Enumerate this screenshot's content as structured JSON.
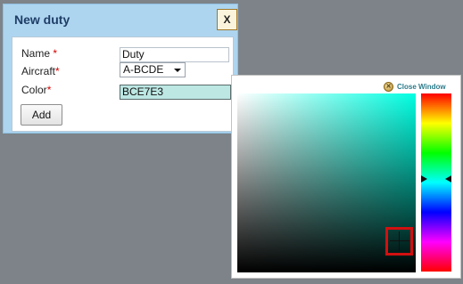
{
  "dialog": {
    "title": "New duty",
    "close_label": "X",
    "fields": {
      "name": {
        "label": "Name",
        "required_mark": "*",
        "value": "Duty"
      },
      "aircraft": {
        "label": "Aircraft",
        "required_mark": "*",
        "value": "A-BCDE"
      },
      "color": {
        "label": "Color",
        "required_mark": "*",
        "value": "BCE7E3",
        "swatch": "#bce7e3"
      }
    },
    "add_label": "Add"
  },
  "color_picker": {
    "close_window_label": "Close Window",
    "close_icon_glyph": "✕",
    "hue_color": "#00ffe2",
    "selected_color": "#bce7e3",
    "hue_fraction": 0.5
  },
  "colors": {
    "dialog_bg": "#add5f0",
    "backdrop": "#7d8388",
    "title": "#1f3e66",
    "required": "#d40000",
    "close_link": "#2b7b8a",
    "selection_box": "#d21010"
  }
}
